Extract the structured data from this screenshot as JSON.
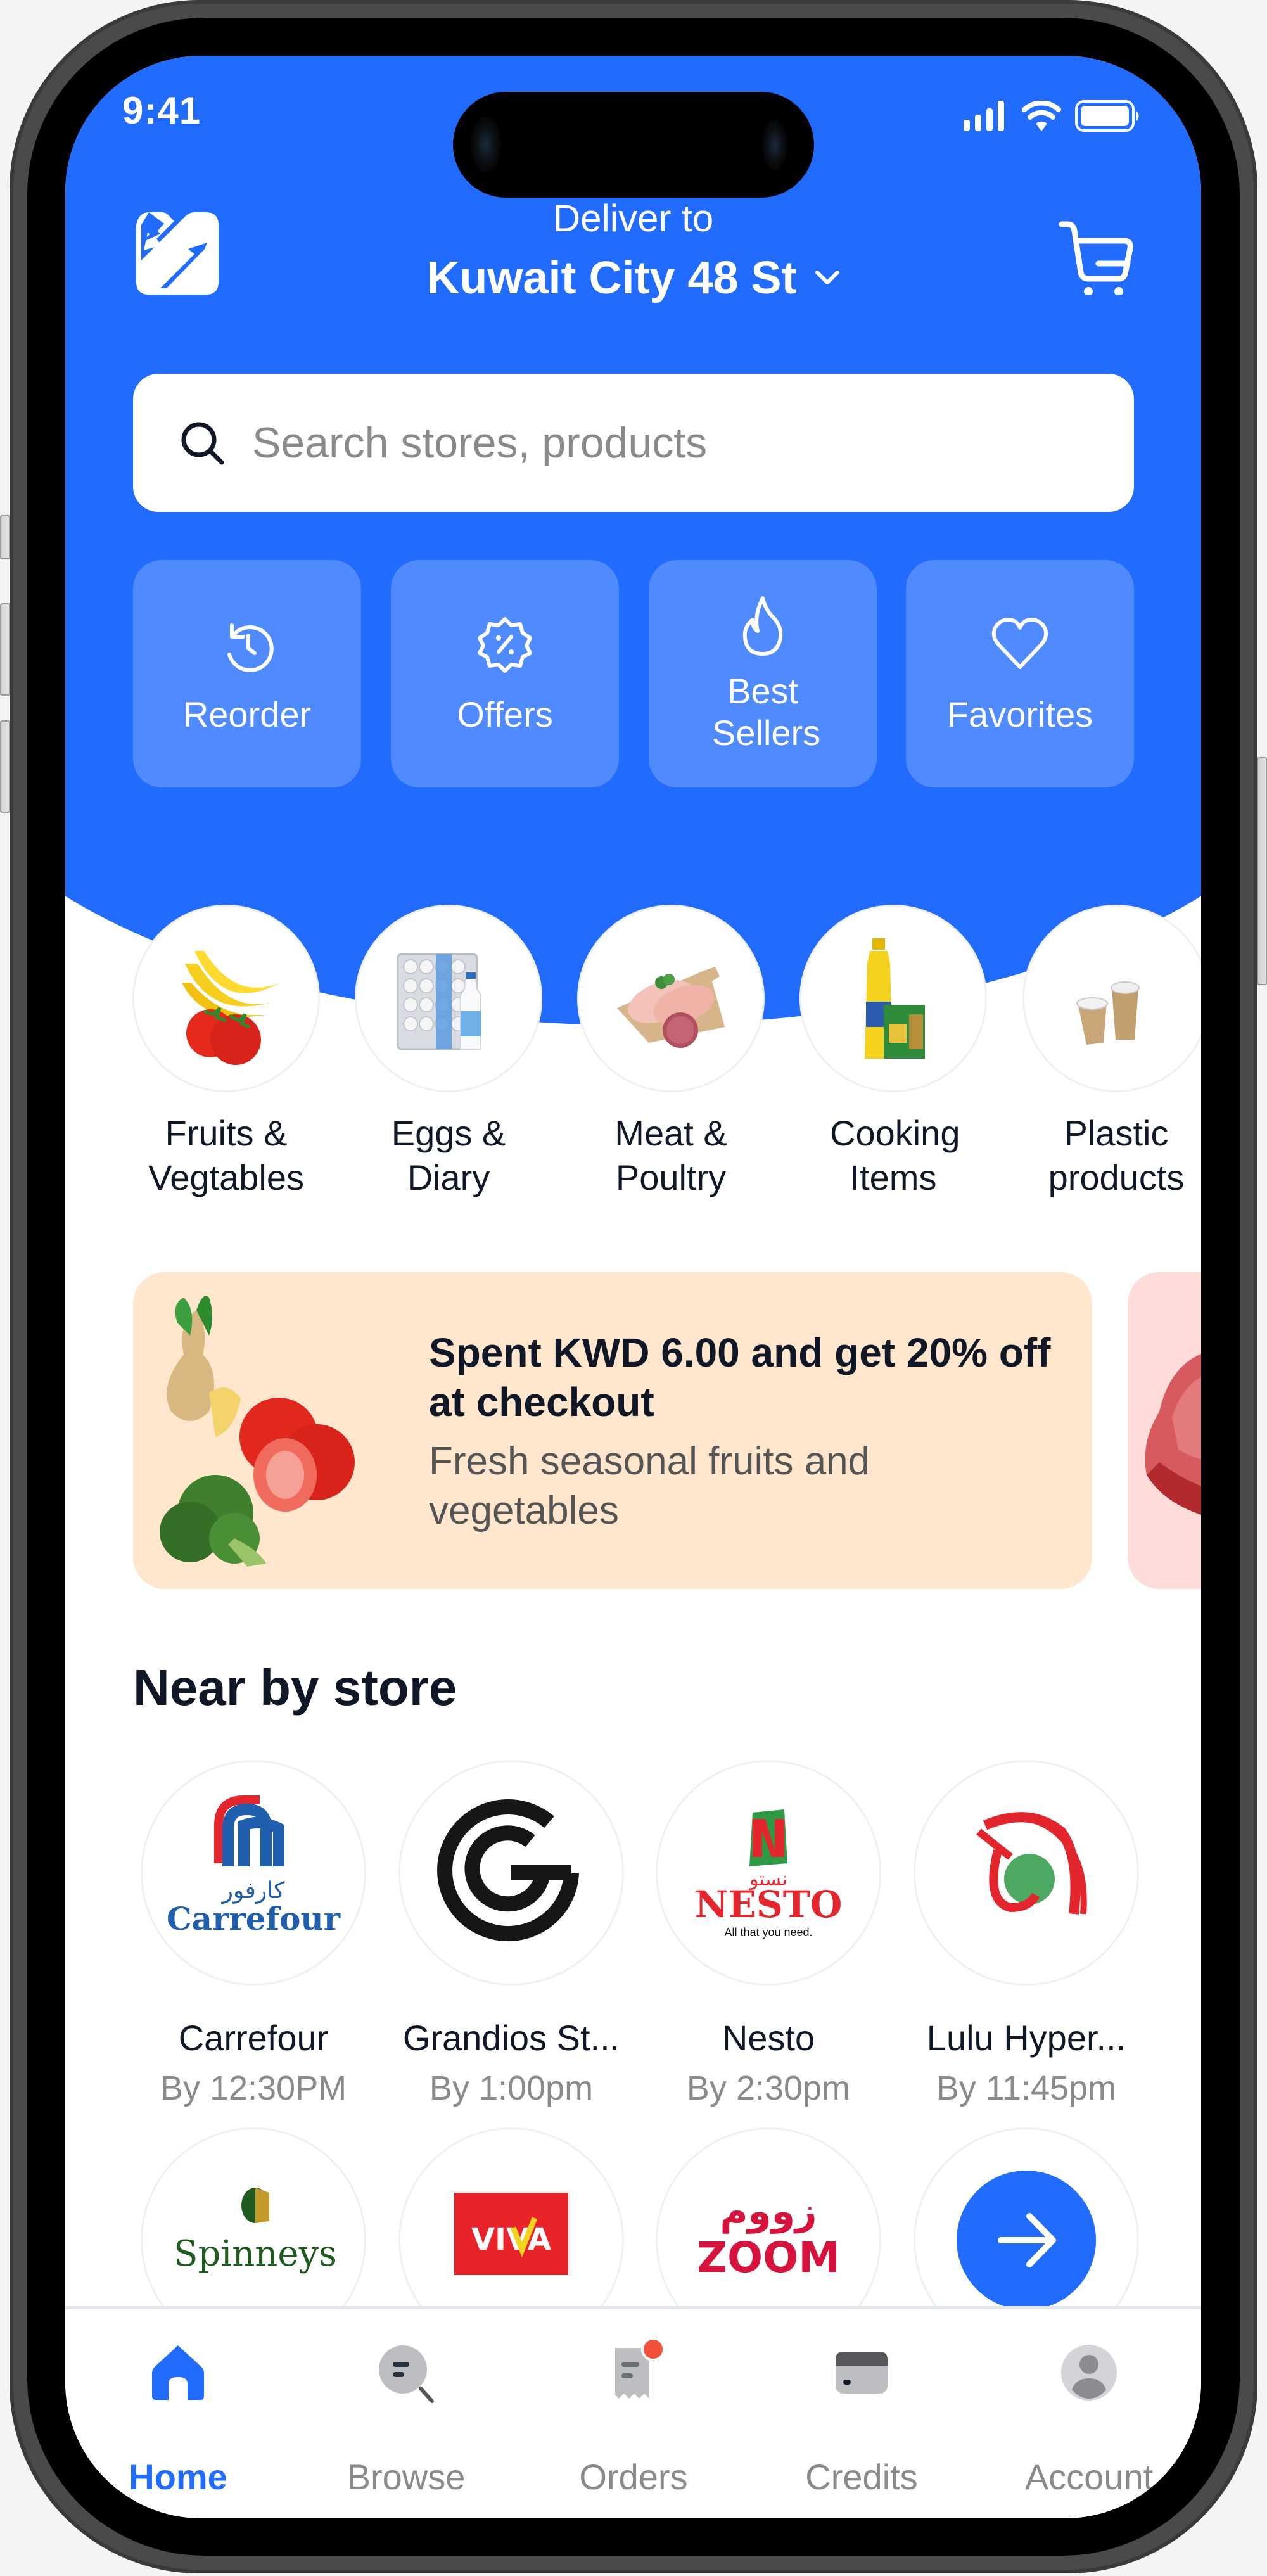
{
  "status_bar": {
    "time": "9:41",
    "icons": [
      "cellular-signal-icon",
      "wifi-icon",
      "battery-icon"
    ]
  },
  "header": {
    "logo": "app-logo",
    "deliver_label": "Deliver to",
    "location": "Kuwait City 48 St",
    "location_icon": "chevron-down-icon",
    "cart_icon": "cart-icon"
  },
  "search": {
    "placeholder": "Search stores, products",
    "value": "",
    "icon": "search-icon"
  },
  "quick_actions": [
    {
      "label": "Reorder",
      "icon": "history-icon"
    },
    {
      "label": "Offers",
      "icon": "discount-badge-icon"
    },
    {
      "label": "Best Sellers",
      "icon": "flame-icon"
    },
    {
      "label": "Favorites",
      "icon": "heart-icon"
    }
  ],
  "categories": [
    {
      "label": "Fruits & Vegtables",
      "image": "bananas-tomatoes-image"
    },
    {
      "label": "Eggs & Diary",
      "image": "eggs-milk-image"
    },
    {
      "label": "Meat & Poultry",
      "image": "chicken-meat-image"
    },
    {
      "label": "Cooking Items",
      "image": "oil-stock-image"
    },
    {
      "label": "Plastic products",
      "image": "paper-cups-image"
    }
  ],
  "promos": [
    {
      "title": "Spent KWD 6.00 and get 20% off at checkout",
      "subtitle": "Fresh seasonal fruits and vegetables",
      "image": "vegetables-image",
      "bg": "#FFE6CC"
    },
    {
      "title": "",
      "subtitle": "",
      "image": "meat-image",
      "bg": "#FFDCDA"
    }
  ],
  "nearby": {
    "title": "Near by store",
    "stores": [
      {
        "name": "Carrefour",
        "time": "By 12:30PM",
        "logo": "carrefour-logo"
      },
      {
        "name": "Grandios St...",
        "time": "By 1:00pm",
        "logo": "grandiose-logo"
      },
      {
        "name": "Nesto",
        "time": "By 2:30pm",
        "logo": "nesto-logo"
      },
      {
        "name": "Lulu Hyper...",
        "time": "By 11:45pm",
        "logo": "lulu-logo"
      },
      {
        "name": "",
        "time": "",
        "logo": "spinneys-logo"
      },
      {
        "name": "",
        "time": "",
        "logo": "viva-logo"
      },
      {
        "name": "",
        "time": "",
        "logo": "zoom-logo"
      }
    ],
    "more_icon": "arrow-right-icon"
  },
  "nav": {
    "items": [
      {
        "label": "Home",
        "icon": "home-icon",
        "active": true
      },
      {
        "label": "Browse",
        "icon": "browse-search-icon",
        "active": false
      },
      {
        "label": "Orders",
        "icon": "receipt-icon",
        "active": false,
        "badge": true
      },
      {
        "label": "Credits",
        "icon": "credit-card-icon",
        "active": false
      },
      {
        "label": "Account",
        "icon": "account-icon",
        "active": false
      }
    ]
  },
  "colors": {
    "brand": "#216BFF",
    "tile": "#4F8BFF",
    "text_primary": "#101828",
    "text_muted": "#8a8a8a",
    "badge": "#F4513A"
  }
}
